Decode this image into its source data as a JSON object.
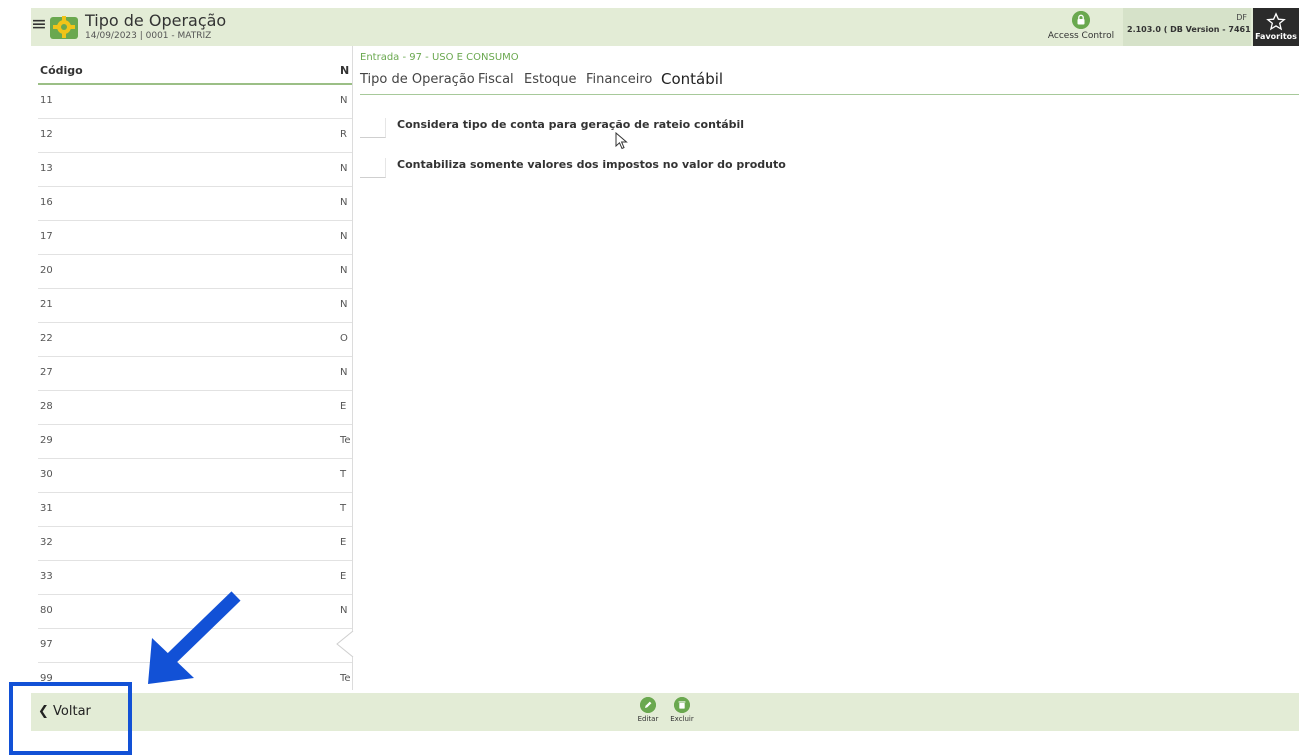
{
  "header": {
    "menu_icon": "hamburger-icon",
    "app_icon": "gear-icon",
    "title": "Tipo de Operação",
    "subtitle": "14/09/2023 | 0001 - MATRIZ",
    "access_control_label": "Access Control",
    "access_control_icon": "lock-icon",
    "version_prefix": "DF",
    "version": "2.103.0 ( DB Version - 7461 )",
    "favoritos_label": "Favoritos",
    "favoritos_icon": "star-icon"
  },
  "list": {
    "headers": {
      "code": "Código",
      "name": "N"
    },
    "rows": [
      {
        "code": "11",
        "name": "N"
      },
      {
        "code": "12",
        "name": "R"
      },
      {
        "code": "13",
        "name": "N"
      },
      {
        "code": "16",
        "name": "N"
      },
      {
        "code": "17",
        "name": "N"
      },
      {
        "code": "20",
        "name": "N"
      },
      {
        "code": "21",
        "name": "N"
      },
      {
        "code": "22",
        "name": "O"
      },
      {
        "code": "27",
        "name": "N"
      },
      {
        "code": "28",
        "name": "E"
      },
      {
        "code": "29",
        "name": "Te"
      },
      {
        "code": "30",
        "name": "T"
      },
      {
        "code": "31",
        "name": "T"
      },
      {
        "code": "32",
        "name": "E"
      },
      {
        "code": "33",
        "name": "E"
      },
      {
        "code": "80",
        "name": "N"
      },
      {
        "code": "97",
        "name": ""
      },
      {
        "code": "99",
        "name": "Te"
      }
    ],
    "selected_code": "97"
  },
  "detail": {
    "breadcrumb": "Entrada - 97 - USO E CONSUMO",
    "tabs": [
      {
        "label": "Tipo de Operação",
        "active": false
      },
      {
        "label": "Fiscal",
        "active": false
      },
      {
        "label": "Estoque",
        "active": false
      },
      {
        "label": "Financeiro",
        "active": false
      },
      {
        "label": "Contábil",
        "active": true
      }
    ],
    "checkboxes": [
      {
        "label": "Considera tipo de conta para geração de rateio contábil",
        "checked": false
      },
      {
        "label": "Contabiliza somente valores dos impostos no valor do produto",
        "checked": false
      }
    ]
  },
  "footer": {
    "back_label": "Voltar",
    "back_icon": "chevron-left-icon",
    "actions": [
      {
        "label": "Editar",
        "icon": "pencil-icon"
      },
      {
        "label": "Excluir",
        "icon": "trash-icon"
      }
    ]
  },
  "colors": {
    "bar_bg": "#e3ecd6",
    "accent_green": "#6aa84f",
    "annotation_blue": "#1251d6"
  }
}
